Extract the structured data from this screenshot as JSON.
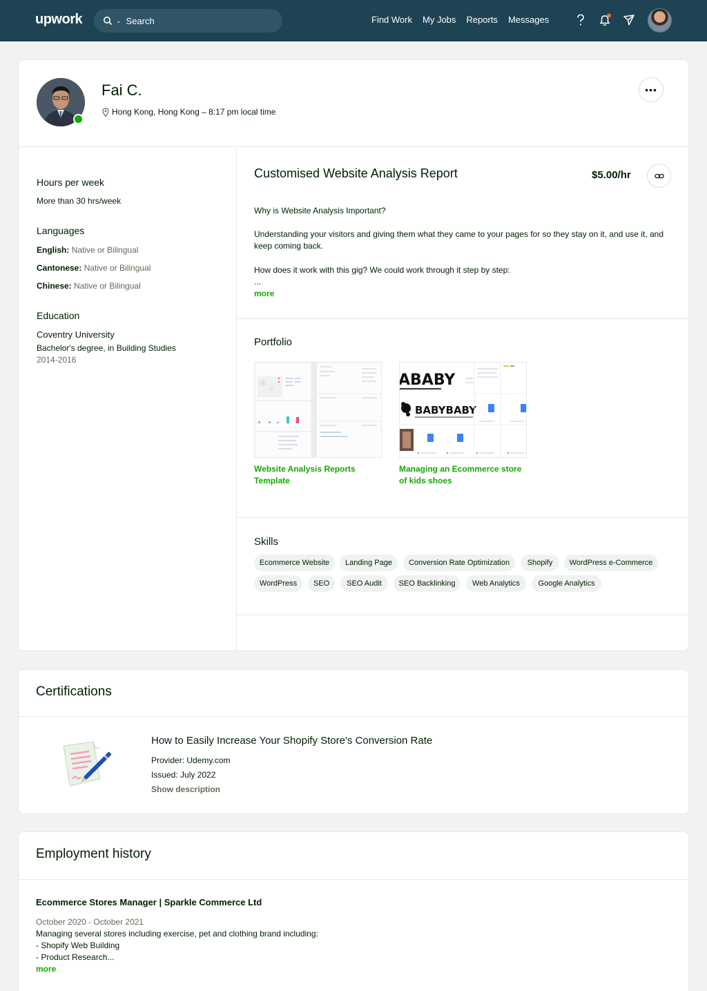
{
  "nav": {
    "logo": "upwork",
    "search_placeholder": "Search",
    "links": [
      "Find Work",
      "My Jobs",
      "Reports",
      "Messages"
    ],
    "icons": [
      "help-icon",
      "bell-icon",
      "send-icon"
    ],
    "brand_color": "#1d4354",
    "notification_dot_color": "#f06b3e"
  },
  "profile": {
    "name": "Fai C.",
    "location": "Hong Kong, Hong Kong – 8:17 pm local time",
    "online_color": "#14a800"
  },
  "sidebar": {
    "hours_heading": "Hours per week",
    "hours_value": "More than 30 hrs/week",
    "languages_heading": "Languages",
    "languages": [
      {
        "name": "English:",
        "level": "Native or Bilingual"
      },
      {
        "name": "Cantonese:",
        "level": "Native or Bilingual"
      },
      {
        "name": "Chinese:",
        "level": "Native or Bilingual"
      }
    ],
    "education_heading": "Education",
    "school": "Coventry University",
    "degree": "Bachelor's degree, in Building Studies",
    "years": "2014-2016"
  },
  "overview": {
    "title": "Customised Website Analysis Report",
    "rate": "$5.00/hr",
    "p1": "Why is Website Analysis Important?",
    "p2": "Understanding your visitors and giving them what they came to your pages for so they stay on it, and use it, and keep coming back.",
    "p3": "How does it work with this gig? We could work through it step by step:",
    "ellipsis": "...",
    "more": "more"
  },
  "portfolio": {
    "heading": "Portfolio",
    "items": [
      {
        "title": "Website Analysis Reports Template"
      },
      {
        "title": "Managing an Ecommerce store of kids shoes",
        "thumb_text": "BABYBABY",
        "thumb_text_top": "ABABY"
      }
    ]
  },
  "skills": {
    "heading": "Skills",
    "items": [
      "Ecommerce Website",
      "Landing Page",
      "Conversion Rate Optimization",
      "Shopify",
      "WordPress e-Commerce",
      "WordPress",
      "SEO",
      "SEO Audit",
      "SEO Backlinking",
      "Web Analytics",
      "Google Analytics"
    ]
  },
  "certifications": {
    "heading": "Certifications",
    "title": "How to Easily Increase Your Shopify Store's Conversion Rate",
    "provider": "Provider: Udemy.com",
    "issued": "Issued: July 2022",
    "show_description": "Show description"
  },
  "employment": {
    "heading": "Employment history",
    "title": "Ecommerce Stores Manager | Sparkle Commerce Ltd",
    "dates": "October 2020 - October 2021",
    "line1": "Managing several stores including exercise, pet and clothing brand including:",
    "line2": "- Shopify Web Building",
    "line3": "- Product Research...",
    "more": "more"
  }
}
